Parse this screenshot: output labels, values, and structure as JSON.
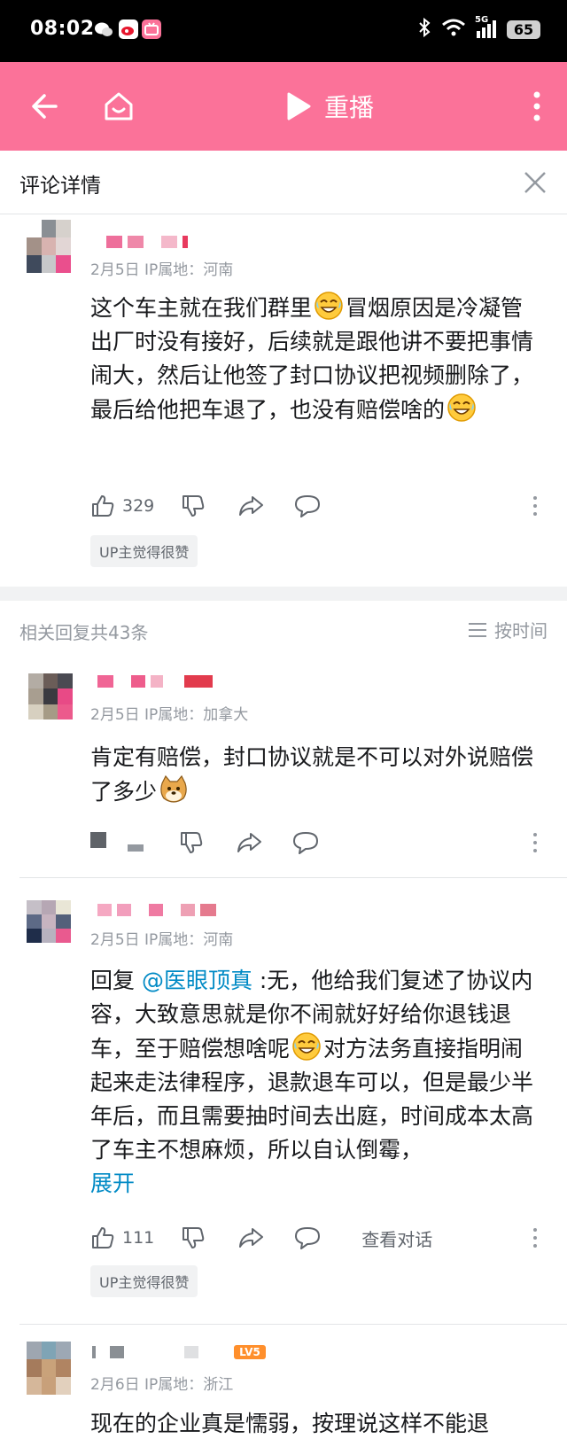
{
  "status_bar": {
    "time": "08:02",
    "network": "5G",
    "battery": "65"
  },
  "nav": {
    "replay_label": "重播"
  },
  "subhead": {
    "title": "评论详情"
  },
  "main_comment": {
    "meta": "2月5日 IP属地：河南",
    "text_1": "这个车主就在我们群里",
    "text_2": "冒烟原因是冷凝管出厂时没有接好，后续就是跟他讲不要把事情闹大，然后让他签了封口协议把视频删除了，最后给他把车退了，也没有赔偿啥的",
    "likes": "329",
    "badge": "UP主觉得很赞"
  },
  "replies_header": {
    "count": "相关回复共43条",
    "sort_label": "按时间"
  },
  "replies": [
    {
      "meta": "2月5日 IP属地：加拿大",
      "text": "肯定有赔偿，封口协议就是不可以对外说赔偿了多少"
    },
    {
      "meta": "2月5日 IP属地：河南",
      "reply_prefix": "回复 ",
      "mention": "@医眼顶真",
      "text_1": " :无，他给我们复述了协议内容，大致意思就是你不闹就好好给你退钱退车，至于赔偿想啥呢",
      "text_2": "对方法务直接指明闹起来走法律程序，退款退车可以，但是最少半年后，而且需要抽时间去出庭，时间成本太高了车主不想麻烦，所以自认倒霉，",
      "expand": "展开",
      "likes": "111",
      "view_conversation": "查看对话",
      "badge": "UP主觉得很赞"
    },
    {
      "meta": "2月6日 IP属地：浙江",
      "level": "LV5",
      "text": "现在的企业真是懦弱，按理说这样不能退"
    }
  ]
}
